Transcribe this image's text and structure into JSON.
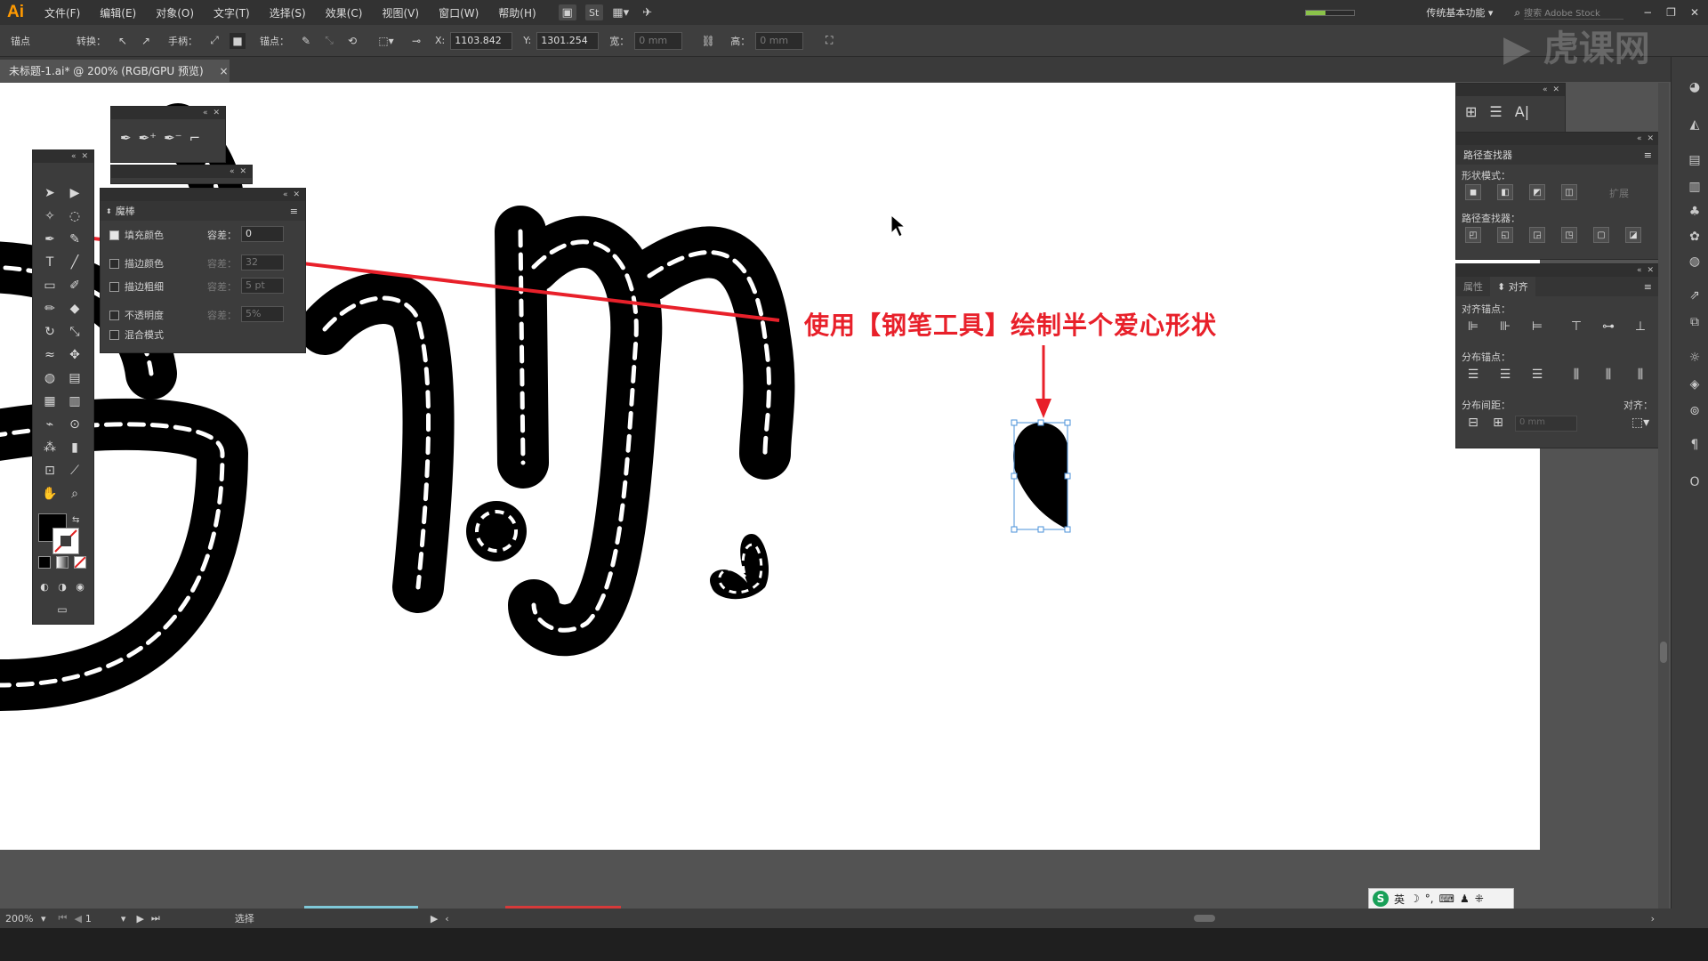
{
  "app": {
    "logo": "Ai"
  },
  "menu": [
    "文件(F)",
    "编辑(E)",
    "对象(O)",
    "文字(T)",
    "选择(S)",
    "效果(C)",
    "视图(V)",
    "窗口(W)",
    "帮助(H)"
  ],
  "menubar_right": {
    "workspace": "传统基本功能",
    "search_placeholder": "搜索 Adobe Stock",
    "st_label": "St"
  },
  "controlbar": {
    "anchor_label": "锚点",
    "convert_label": "转换：",
    "handle_label": "手柄：",
    "anchor2_label": "锚点：",
    "x_label": "X:",
    "x_value": "1103.842",
    "y_label": "Y:",
    "y_value": "1301.254",
    "w_label": "宽：",
    "w_value": "0 mm",
    "h_label": "高：",
    "h_value": "0 mm"
  },
  "document": {
    "tab_title": "未标题-1.ai* @ 200% (RGB/GPU 预览)",
    "close": "×"
  },
  "magic_wand_panel": {
    "title": "魔棒",
    "rows": [
      {
        "label": "填充颜色",
        "checked": true,
        "tol_label": "容差：",
        "tol_value": "0"
      },
      {
        "label": "描边颜色",
        "checked": false,
        "tol_label": "容差：",
        "tol_value": "32"
      },
      {
        "label": "描边粗细",
        "checked": false,
        "tol_label": "容差：",
        "tol_value": "5 pt"
      },
      {
        "label": "不透明度",
        "checked": false,
        "tol_label": "容差：",
        "tol_value": "5%"
      },
      {
        "label": "混合模式",
        "checked": false
      }
    ]
  },
  "annotation": {
    "text": "使用【钢笔工具】绘制半个爱心形状",
    "color": "#e8202a"
  },
  "pathfinder_panel": {
    "title": "路径查找器",
    "shape_modes_label": "形状模式：",
    "expand_label": "扩展",
    "pathfinders_label": "路径查找器："
  },
  "align_panel": {
    "tab_properties": "属性",
    "tab_align": "对齐",
    "align_objects_label": "对齐锚点：",
    "distribute_label": "分布锚点：",
    "spacing_label": "分布间距：",
    "spacing_value": "0 mm",
    "align_to_label": "对齐："
  },
  "status": {
    "zoom": "200%",
    "page": "1",
    "tool": "选择"
  },
  "ime": {
    "logo": "S",
    "lang": "英"
  },
  "watermark": "虎课网",
  "colors": {
    "accent": "#ff9a00",
    "annotation": "#e8202a",
    "canvas": "#ffffff"
  }
}
